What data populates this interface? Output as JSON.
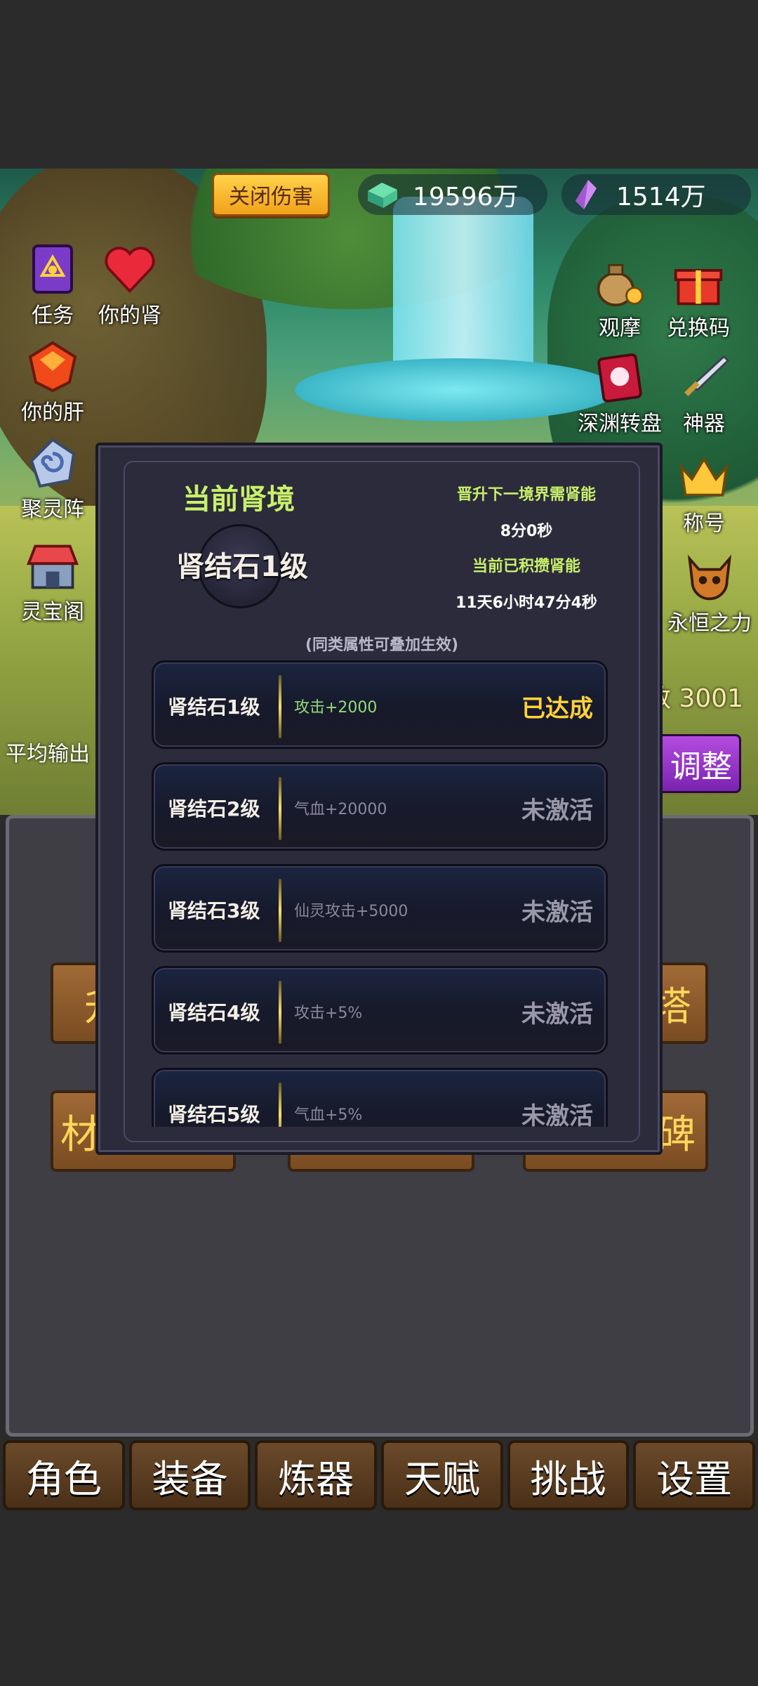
{
  "header": {
    "close_damage_label": "关闭伤害",
    "currency_jade": "19596万",
    "currency_crystal": "1514万"
  },
  "left_icons": {
    "task": "任务",
    "kidney": "你的肾",
    "liver": "你的肝",
    "spirit_array": "聚灵阵",
    "treasure_pavilion": "灵宝阁"
  },
  "right_icons": {
    "observe": "观摩",
    "redeem_code": "兑换码",
    "abyss_wheel": "深渊转盘",
    "artifact": "神器",
    "title": "称号",
    "eternal_power": "永恒之力"
  },
  "battle": {
    "damage_value": "数 3001",
    "avg_output": "平均输出",
    "adjust_label": "调整"
  },
  "menu_buttons": {
    "b1": "升",
    "b2": "塔",
    "b3": "材",
    "b4": "",
    "b5": "碑"
  },
  "tabs": [
    "角色",
    "装备",
    "炼器",
    "天赋",
    "挑战",
    "设置"
  ],
  "modal": {
    "title": "当前肾境",
    "current_level": "肾结石1级",
    "next_req_label": "晋升下一境界需肾能",
    "next_req_time": "8分0秒",
    "accumulated_label": "当前已积攒肾能",
    "accumulated_time": "11天6小时47分4秒",
    "note": "(同类属性可叠加生效)",
    "rows": [
      {
        "name": "肾结石1级",
        "attr": "攻击+2000",
        "status": "已达成"
      },
      {
        "name": "肾结石2级",
        "attr": "气血+20000",
        "status": "未激活"
      },
      {
        "name": "肾结石3级",
        "attr": "仙灵攻击+5000",
        "status": "未激活"
      },
      {
        "name": "肾结石4级",
        "attr": "攻击+5%",
        "status": "未激活"
      },
      {
        "name": "肾结石5级",
        "attr": "气血+5%",
        "status": "未激活"
      }
    ]
  },
  "colors": {
    "achieved": "#ffd23a",
    "inactive": "#9a98a8",
    "attr_active": "#8fdc7a",
    "attr_inactive": "#8a889a",
    "modal_title": "#c8f06a"
  }
}
